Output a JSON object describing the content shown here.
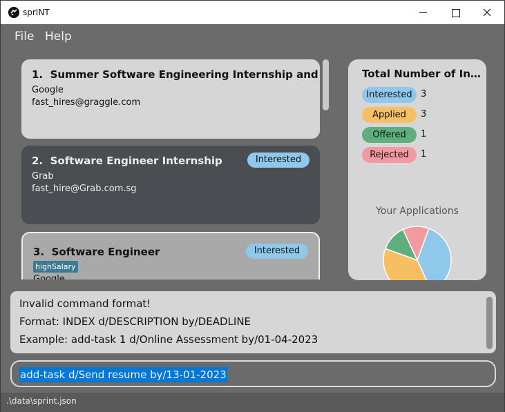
{
  "window": {
    "title": "sprINT",
    "icons": {
      "logo": "app-logo-icon",
      "minimize": "minimize-icon",
      "maximize": "maximize-icon",
      "close": "close-icon"
    }
  },
  "menu": {
    "file": "File",
    "help": "Help"
  },
  "applications": [
    {
      "index": "1.",
      "title": "Summer Software Engineering Internship and Site Reliability",
      "company": "Google",
      "email": "fast_hires@graggle.com",
      "status": "",
      "tag": ""
    },
    {
      "index": "2.",
      "title": "Software Engineer Internship",
      "company": "Grab",
      "email": "fast_hire@Grab.com.sg",
      "status": "Interested",
      "tag": ""
    },
    {
      "index": "3.",
      "title": "Software Engineer",
      "company": "Google",
      "email": "",
      "status": "Interested",
      "tag": "highSalary"
    }
  ],
  "stats": {
    "title": "Total Number of Internships",
    "rows": [
      {
        "label": "Interested",
        "count": "3",
        "color": "#90c8ec"
      },
      {
        "label": "Applied",
        "count": "3",
        "color": "#f7bf63"
      },
      {
        "label": "Offered",
        "count": "1",
        "color": "#5eae7e"
      },
      {
        "label": "Rejected",
        "count": "1",
        "color": "#f29a9f"
      }
    ],
    "chart_title": "Your Applications"
  },
  "chart_data": {
    "type": "pie",
    "categories": [
      "Interested",
      "Applied",
      "Offered",
      "Rejected"
    ],
    "values": [
      3,
      3,
      1,
      1
    ],
    "colors": [
      "#90c8ec",
      "#f7bf63",
      "#5eae7e",
      "#f29a9f"
    ]
  },
  "result": {
    "lines": [
      "Invalid command format!",
      "Format: INDEX d/DESCRIPTION by/DEADLINE",
      "Example: add-task 1 d/Online Assessment by/01-04-2023"
    ]
  },
  "command": {
    "value": "add-task d/Send resume by/13-01-2023"
  },
  "status_bar": {
    "path": ".\\data\\sprint.json"
  }
}
